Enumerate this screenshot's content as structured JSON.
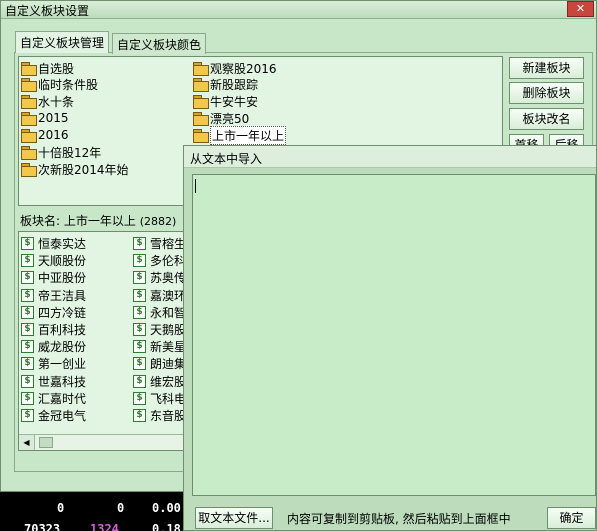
{
  "window": {
    "title": "自定义板块设置"
  },
  "tabs": [
    {
      "label": "自定义板块管理",
      "active": true
    },
    {
      "label": "自定义板块颜色",
      "active": false
    }
  ],
  "folders": [
    {
      "label": "自选股"
    },
    {
      "label": "临时条件股"
    },
    {
      "label": "水十条"
    },
    {
      "label": "2015"
    },
    {
      "label": "2016"
    },
    {
      "label": "十倍股12年"
    },
    {
      "label": "次新股2014年始"
    },
    {
      "label": "观察股2016"
    },
    {
      "label": "新股跟踪"
    },
    {
      "label": "牛安牛安"
    },
    {
      "label": "漂亮50"
    },
    {
      "label": "上市一年以上",
      "selected": true
    }
  ],
  "buttons": {
    "new": "新建板块",
    "delete": "删除板块",
    "rename": "板块改名",
    "first": "首移",
    "prev": "后移"
  },
  "block": {
    "label": "板块名:",
    "name": "上市一年以上",
    "count": "(2882)"
  },
  "stocks_col1": [
    "恒泰实达",
    "天顺股份",
    "中亚股份",
    "帝王洁具",
    "四方冷链",
    "百利科技",
    "威龙股份",
    "第一创业",
    "世嘉科技",
    "汇嘉时代",
    "金冠电气"
  ],
  "stocks_col2": [
    "雪榕生",
    "多伦科",
    "苏奥传",
    "嘉澳环",
    "永和智",
    "天鹅股",
    "新美星",
    "朗迪集",
    "维宏股",
    "飞科电",
    "东音股"
  ],
  "stock_icon_glyph": "$",
  "import_dialog": {
    "title": "从文本中导入",
    "text_value": "",
    "file_button": "取文本文件...",
    "hint": "内容可复制到剪贴板, 然后粘贴到上面框中",
    "ok_button": "确定"
  },
  "background": {
    "numbers": [
      {
        "text": "0",
        "color": "#ffffff"
      },
      {
        "text": "0",
        "color": "#ffffff"
      },
      {
        "text": "0.00",
        "color": "#ffffff"
      },
      {
        "text": "70323",
        "color": "#ffffff"
      },
      {
        "text": "1324",
        "color": "#d060d0"
      },
      {
        "text": "0.18",
        "color": "#ffffff"
      }
    ]
  },
  "colors": {
    "dialog_bg": "#c8e6c8",
    "list_bg": "#e2f4e2",
    "import_text_bg": "#c8ecc8",
    "close_button": "#c9463d"
  }
}
